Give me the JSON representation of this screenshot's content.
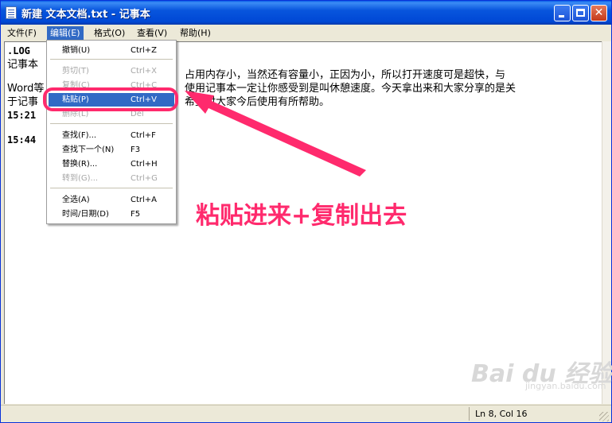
{
  "window": {
    "title": "新建 文本文档.txt - 记事本"
  },
  "menubar": [
    {
      "label": "文件(F)"
    },
    {
      "label": "编辑(E)"
    },
    {
      "label": "格式(O)"
    },
    {
      "label": "查看(V)"
    },
    {
      "label": "帮助(H)"
    }
  ],
  "editor": {
    "lines": [
      ".LOG",
      "记事本",
      "Word等",
      "于记事",
      "15:21",
      "15:44"
    ],
    "right_text": [
      "占用内存小，当然还有容量小，正因为小，所以打开速度可是超快，与",
      "使用记事本一定让你感受到是叫休憩速度。今天拿出来和大家分享的是关",
      "希望对大家今后使用有所帮助。"
    ]
  },
  "edit_menu": {
    "items": [
      {
        "label": "撤销(U)",
        "shortcut": "Ctrl+Z",
        "state": "enabled"
      },
      {
        "label": "剪切(T)",
        "shortcut": "Ctrl+X",
        "state": "disabled"
      },
      {
        "label": "复制(C)",
        "shortcut": "Ctrl+C",
        "state": "disabled"
      },
      {
        "label": "粘贴(P)",
        "shortcut": "Ctrl+V",
        "state": "highlighted"
      },
      {
        "label": "删除(L)",
        "shortcut": "Del",
        "state": "disabled"
      },
      {
        "label": "查找(F)...",
        "shortcut": "Ctrl+F",
        "state": "enabled"
      },
      {
        "label": "查找下一个(N)",
        "shortcut": "F3",
        "state": "enabled"
      },
      {
        "label": "替换(R)...",
        "shortcut": "Ctrl+H",
        "state": "enabled"
      },
      {
        "label": "转到(G)...",
        "shortcut": "Ctrl+G",
        "state": "disabled"
      },
      {
        "label": "全选(A)",
        "shortcut": "Ctrl+A",
        "state": "enabled"
      },
      {
        "label": "时间/日期(D)",
        "shortcut": "F5",
        "state": "enabled"
      }
    ]
  },
  "statusbar": {
    "position": "Ln 8, Col 16"
  },
  "annotation": {
    "caption": "粘贴进来+复制出去",
    "color": "#FF2A6D"
  },
  "watermark": {
    "brand": "Bai du 经验",
    "sub": "jingyan.baidu.com"
  }
}
